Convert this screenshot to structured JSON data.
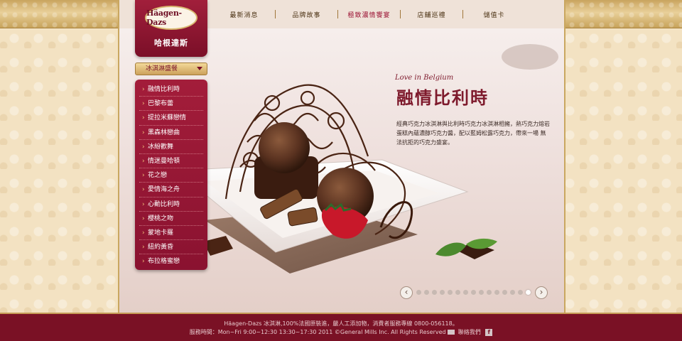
{
  "brand": {
    "logo_text": "Häagen-Dazs",
    "logo_cn": "哈根達斯"
  },
  "nav": {
    "items": [
      {
        "label": "最新消息"
      },
      {
        "label": "品牌故事"
      },
      {
        "label": "極致濃情饗宴"
      },
      {
        "label": "店舖巡禮"
      },
      {
        "label": "儲值卡"
      }
    ],
    "active_index": 2
  },
  "sidebar": {
    "dropdown_label": "冰淇淋盛餐",
    "items": [
      {
        "label": "融情比利時"
      },
      {
        "label": "巴黎布蕾"
      },
      {
        "label": "提拉米蘇戀情"
      },
      {
        "label": "黑森林戀曲"
      },
      {
        "label": "冰紛歡舞"
      },
      {
        "label": "情迷曼哈頓"
      },
      {
        "label": "花之戀"
      },
      {
        "label": "愛情海之舟"
      },
      {
        "label": "心動比利時"
      },
      {
        "label": "櫻桃之吻"
      },
      {
        "label": "蒙地卡羅"
      },
      {
        "label": "紐約黃昏"
      },
      {
        "label": "布拉格蜜戀"
      }
    ]
  },
  "feature": {
    "tagline": "Love in Belgium",
    "title": "融情比利時",
    "description": "經典巧克力冰淇淋與比利時巧克力冰淇淋相擁，熱巧克力熔岩蛋糕內蘊濃醇巧克力醬，配以藍姆松露巧克力，帶來一場 無法抗拒的巧克力盛宴。"
  },
  "slider": {
    "prev_symbol": "‹",
    "next_symbol": "›",
    "dot_count": 15,
    "active_dot": 14
  },
  "footer": {
    "line1": "Häagen-Dazs 冰淇淋,100%法國原裝進，嚴人工添加物，消費者服務專線 0800-056118。",
    "line2_prefix": "服務時間：Mon~Fri 9:00~12:30 13:30~17:30 2011 ©General Mills Inc. All Rights Reserved",
    "contact_label": "聯絡我們",
    "fb_glyph": "f"
  },
  "colors": {
    "brand_red": "#8a1230",
    "gold": "#c9a45e",
    "footer_bg": "#7a1125"
  }
}
